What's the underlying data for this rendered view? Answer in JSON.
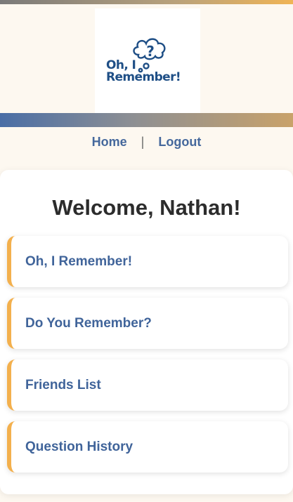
{
  "logo": {
    "line1": "Oh, I",
    "line2": "Remember!",
    "mark": "?",
    "icon": "thought-bubble-question-icon",
    "color": "#1f4f86"
  },
  "nav": {
    "home": "Home",
    "separator": "|",
    "logout": "Logout"
  },
  "main": {
    "welcome": "Welcome, Nathan!",
    "menu": [
      {
        "label": "Oh, I Remember!"
      },
      {
        "label": "Do You Remember?"
      },
      {
        "label": "Friends List"
      },
      {
        "label": "Question History"
      }
    ]
  },
  "colors": {
    "accent": "#f3b04d",
    "link": "#45689c",
    "background": "#fdf8f0"
  }
}
